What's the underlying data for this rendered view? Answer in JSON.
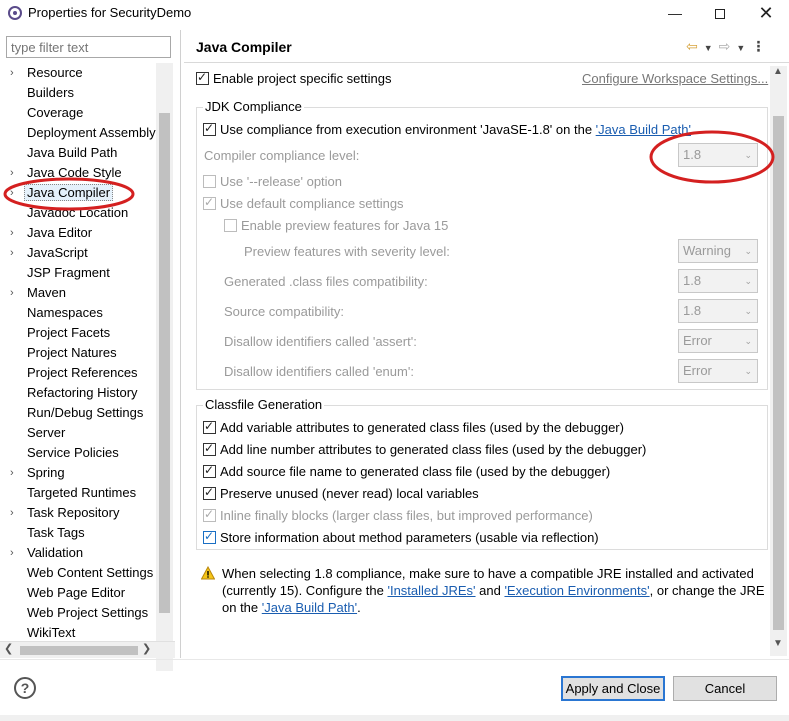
{
  "window": {
    "title": "Properties for SecurityDemo",
    "minimize": "—",
    "close": "✕"
  },
  "filter": {
    "placeholder": "type filter text"
  },
  "sidebar": {
    "items": [
      {
        "label": "Resource",
        "expandable": true
      },
      {
        "label": "Builders",
        "expandable": false
      },
      {
        "label": "Coverage",
        "expandable": false
      },
      {
        "label": "Deployment Assembly",
        "expandable": false
      },
      {
        "label": "Java Build Path",
        "expandable": false
      },
      {
        "label": "Java Code Style",
        "expandable": true
      },
      {
        "label": "Java Compiler",
        "expandable": true,
        "selected": true
      },
      {
        "label": "Javadoc Location",
        "expandable": false
      },
      {
        "label": "Java Editor",
        "expandable": true
      },
      {
        "label": "JavaScript",
        "expandable": true
      },
      {
        "label": "JSP Fragment",
        "expandable": false
      },
      {
        "label": "Maven",
        "expandable": true
      },
      {
        "label": "Namespaces",
        "expandable": false
      },
      {
        "label": "Project Facets",
        "expandable": false
      },
      {
        "label": "Project Natures",
        "expandable": false
      },
      {
        "label": "Project References",
        "expandable": false
      },
      {
        "label": "Refactoring History",
        "expandable": false
      },
      {
        "label": "Run/Debug Settings",
        "expandable": false
      },
      {
        "label": "Server",
        "expandable": false
      },
      {
        "label": "Service Policies",
        "expandable": false
      },
      {
        "label": "Spring",
        "expandable": true
      },
      {
        "label": "Targeted Runtimes",
        "expandable": false
      },
      {
        "label": "Task Repository",
        "expandable": true
      },
      {
        "label": "Task Tags",
        "expandable": false
      },
      {
        "label": "Validation",
        "expandable": true
      },
      {
        "label": "Web Content Settings",
        "expandable": false
      },
      {
        "label": "Web Page Editor",
        "expandable": false
      },
      {
        "label": "Web Project Settings",
        "expandable": false
      },
      {
        "label": "WikiText",
        "expandable": false
      }
    ]
  },
  "page": {
    "title": "Java Compiler",
    "enable_project_specific": "Enable project specific settings",
    "configure_workspace": "Configure Workspace Settings..."
  },
  "jdk": {
    "group_title": "JDK Compliance",
    "use_compliance_prefix": "Use compliance from execution environment 'JavaSE-1.8' on the ",
    "use_compliance_link": "'Java Build Path'",
    "compliance_level_label": "Compiler compliance level:",
    "compliance_level_value": "1.8",
    "release_option": "Use '--release' option",
    "use_default": "Use default compliance settings",
    "enable_preview": "Enable preview features for Java 15",
    "preview_severity_label": "Preview features with severity level:",
    "preview_severity_value": "Warning",
    "class_compat_label": "Generated .class files compatibility:",
    "class_compat_value": "1.8",
    "source_compat_label": "Source compatibility:",
    "source_compat_value": "1.8",
    "assert_label": "Disallow identifiers called 'assert':",
    "assert_value": "Error",
    "enum_label": "Disallow identifiers called 'enum':",
    "enum_value": "Error"
  },
  "classfile": {
    "group_title": "Classfile Generation",
    "opt1": "Add variable attributes to generated class files (used by the debugger)",
    "opt2": "Add line number attributes to generated class files (used by the debugger)",
    "opt3": "Add source file name to generated class file (used by the debugger)",
    "opt4": "Preserve unused (never read) local variables",
    "opt5": "Inline finally blocks (larger class files, but improved performance)",
    "opt6": "Store information about method parameters (usable via reflection)"
  },
  "warning": {
    "line1": "When selecting 1.8 compliance, make sure to have a compatible JRE installed and activated",
    "line2_a": "(currently 15). Configure the ",
    "link_jres": "'Installed JREs'",
    "line2_b": " and ",
    "link_envs": "'Execution Environments'",
    "line2_c": ", or change the JRE",
    "line3_a": "on the ",
    "link_build_path": "'Java Build Path'",
    "line3_b": "."
  },
  "buttons": {
    "help": "?",
    "apply_close": "Apply and Close",
    "cancel": "Cancel"
  },
  "colors": {
    "annotation": "#d42020",
    "link": "#1a5db0"
  }
}
